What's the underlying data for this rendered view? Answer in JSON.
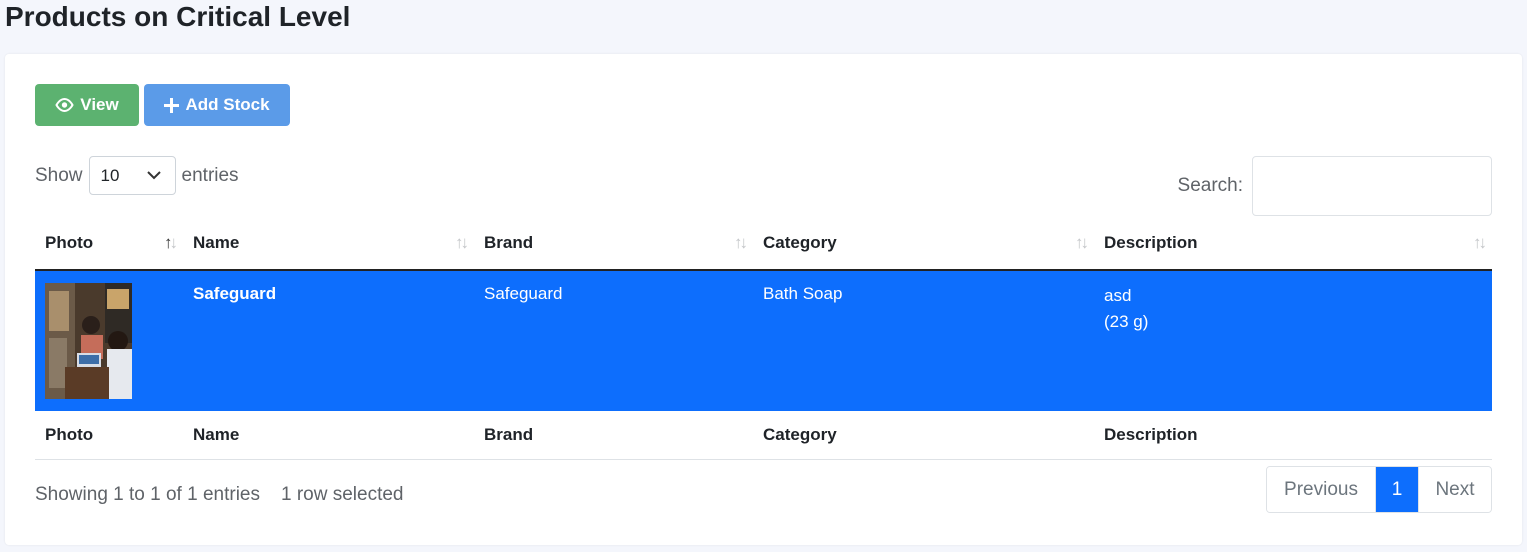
{
  "page": {
    "title": "Products on Critical Level"
  },
  "toolbar": {
    "view_label": "View",
    "add_stock_label": "Add Stock"
  },
  "length_menu": {
    "show_label": "Show",
    "selected": "10",
    "entries_label": "entries"
  },
  "search": {
    "label": "Search:",
    "value": ""
  },
  "table": {
    "columns": [
      "Photo",
      "Name",
      "Brand",
      "Category",
      "Description"
    ],
    "sorted_column": "Photo",
    "rows": [
      {
        "name": "Safeguard",
        "brand": "Safeguard",
        "category": "Bath Soap",
        "description": "asd",
        "size": "(23 g)",
        "selected": true
      }
    ]
  },
  "footer": {
    "info": "Showing 1 to 1 of 1 entries",
    "selection_info": "1 row selected"
  },
  "pagination": {
    "previous_label": "Previous",
    "current_page": "1",
    "next_label": "Next"
  },
  "colors": {
    "view_button": "#5cb270",
    "add_stock_button": "#5b9be8",
    "selected_row": "#0d6efd",
    "active_page": "#0d6efd",
    "page_background": "#f4f6fc"
  },
  "icons": {
    "view": "eye-icon",
    "add_stock": "plus-icon",
    "select": "chevron-down-icon",
    "sort": "sort-arrows-icon"
  }
}
